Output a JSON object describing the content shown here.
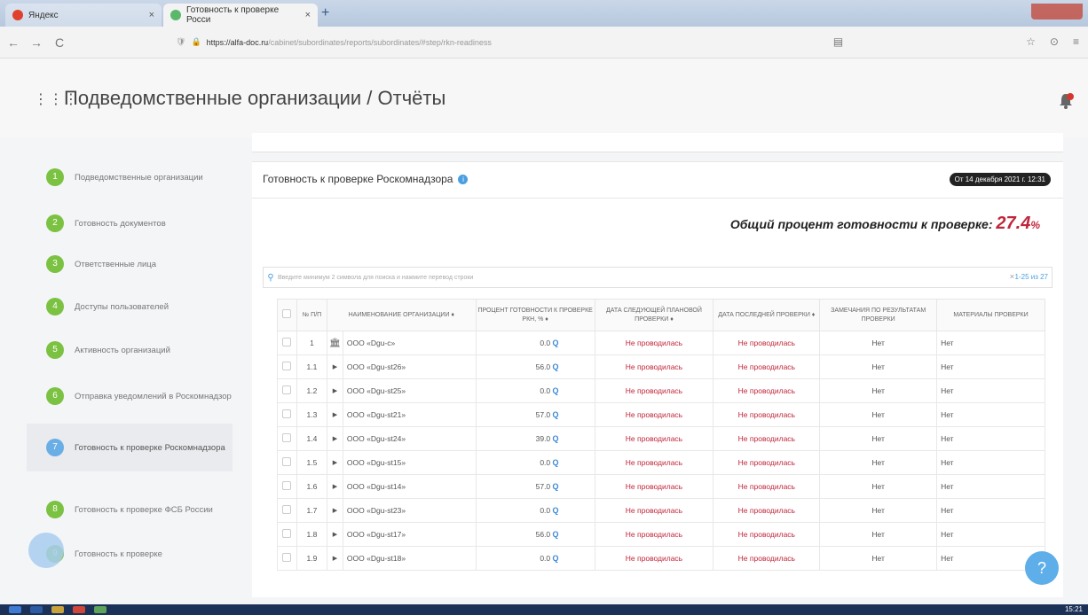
{
  "browser": {
    "tab1_label": "Яндекс",
    "tab2_label": "Готовность к проверке Росси",
    "tab_close": "×",
    "new_tab": "+",
    "url_host": "https://alfa-doc.ru",
    "url_path": "/cabinet/subordinates/reports/subordinates/#step/rkn-readiness",
    "back": "←",
    "forward": "→",
    "reload": "C"
  },
  "header": {
    "menu_icon": "⋮⋮⋮",
    "title": "Подведомственные организации / Отчёты"
  },
  "sidebar": {
    "items": [
      {
        "num": "1",
        "label": "Подведомственные организации"
      },
      {
        "num": "2",
        "label": "Готовность документов"
      },
      {
        "num": "3",
        "label": "Ответственные лица"
      },
      {
        "num": "4",
        "label": "Доступы пользователей"
      },
      {
        "num": "5",
        "label": "Активность организаций"
      },
      {
        "num": "6",
        "label": "Отправка уведомлений в Роскомнадзор"
      },
      {
        "num": "7",
        "label": "Готовность к проверке Роскомнадзора"
      },
      {
        "num": "8",
        "label": "Готовность к проверке ФСБ России"
      },
      {
        "num": "9",
        "label": "Готовность к проверке"
      }
    ]
  },
  "panel": {
    "title": "Готовность к проверке Роскомнадзора",
    "date_badge": "От 14 декабря 2021 г. 12:31",
    "readiness_label": "Общий процент готовности к проверке:",
    "readiness_value": "27.4",
    "readiness_sign": "%",
    "search_placeholder": "Введите минимум 2 символа для поиска и нажмите перевод строки",
    "search_clear": "×",
    "pagination": "1-25 из 27"
  },
  "table": {
    "headers": {
      "num": "№ П/П",
      "name": "НАИМЕНОВАНИЕ ОРГАНИЗАЦИИ ♦",
      "percent": "ПРОЦЕНТ ГОТОВНОСТИ К ПРОВЕРКЕ РКН, % ♦",
      "next_date": "ДАТА СЛЕДУЮЩЕЙ ПЛАНОВОЙ ПРОВЕРКИ ♦",
      "last_date": "ДАТА ПОСЛЕДНЕЙ ПРОВЕРКИ ♦",
      "remarks": "ЗАМЕЧАНИЯ ПО РЕЗУЛЬТАТАМ ПРОВЕРКИ",
      "materials": "МАТЕРИАЛЫ ПРОВЕРКИ"
    },
    "rows": [
      {
        "num": "1",
        "marker": "🏛",
        "name": "ООО «Dgu-c»",
        "percent": "0.0",
        "next": "Не проводилась",
        "last": "Не проводилась",
        "remarks": "Нет",
        "materials": "Нет"
      },
      {
        "num": "1.1",
        "marker": "▶",
        "name": "ООО «Dgu-st26»",
        "percent": "56.0",
        "next": "Не проводилась",
        "last": "Не проводилась",
        "remarks": "Нет",
        "materials": "Нет"
      },
      {
        "num": "1.2",
        "marker": "▶",
        "name": "ООО «Dgu-st25»",
        "percent": "0.0",
        "next": "Не проводилась",
        "last": "Не проводилась",
        "remarks": "Нет",
        "materials": "Нет"
      },
      {
        "num": "1.3",
        "marker": "▶",
        "name": "ООО «Dgu-st21»",
        "percent": "57.0",
        "next": "Не проводилась",
        "last": "Не проводилась",
        "remarks": "Нет",
        "materials": "Нет"
      },
      {
        "num": "1.4",
        "marker": "▶",
        "name": "ООО «Dgu-st24»",
        "percent": "39.0",
        "next": "Не проводилась",
        "last": "Не проводилась",
        "remarks": "Нет",
        "materials": "Нет"
      },
      {
        "num": "1.5",
        "marker": "▶",
        "name": "ООО «Dgu-st15»",
        "percent": "0.0",
        "next": "Не проводилась",
        "last": "Не проводилась",
        "remarks": "Нет",
        "materials": "Нет"
      },
      {
        "num": "1.6",
        "marker": "▶",
        "name": "ООО «Dgu-st14»",
        "percent": "57.0",
        "next": "Не проводилась",
        "last": "Не проводилась",
        "remarks": "Нет",
        "materials": "Нет"
      },
      {
        "num": "1.7",
        "marker": "▶",
        "name": "ООО «Dgu-st23»",
        "percent": "0.0",
        "next": "Не проводилась",
        "last": "Не проводилась",
        "remarks": "Нет",
        "materials": "Нет"
      },
      {
        "num": "1.8",
        "marker": "▶",
        "name": "ООО «Dgu-st17»",
        "percent": "56.0",
        "next": "Не проводилась",
        "last": "Не проводилась",
        "remarks": "Нет",
        "materials": "Нет"
      },
      {
        "num": "1.9",
        "marker": "▶",
        "name": "ООО «Dgu-st18»",
        "percent": "0.0",
        "next": "Не проводилась",
        "last": "Не проводилась",
        "remarks": "Нет",
        "materials": "Нет"
      }
    ]
  },
  "help_button": "?",
  "taskbar": {
    "clock": "15:21"
  },
  "colors": {
    "accent_green": "#7cc242",
    "accent_blue": "#5eaeea",
    "alert_red": "#c0263a"
  }
}
